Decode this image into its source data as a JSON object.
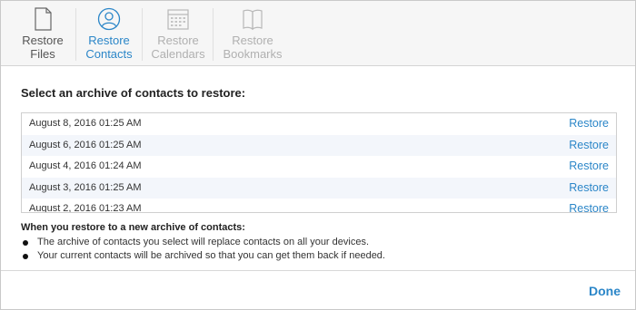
{
  "toolbar": {
    "tabs": [
      {
        "line1": "Restore",
        "line2": "Files",
        "icon": "document-icon",
        "state": "normal"
      },
      {
        "line1": "Restore",
        "line2": "Contacts",
        "icon": "contacts-icon",
        "state": "active"
      },
      {
        "line1": "Restore",
        "line2": "Calendars",
        "icon": "calendar-icon",
        "state": "disabled"
      },
      {
        "line1": "Restore",
        "line2": "Bookmarks",
        "icon": "bookmarks-icon",
        "state": "disabled"
      }
    ]
  },
  "main": {
    "heading": "Select an archive of contacts to restore:",
    "archives": [
      {
        "date": "August 8, 2016 01:25 AM",
        "action": "Restore"
      },
      {
        "date": "August 6, 2016 01:25 AM",
        "action": "Restore"
      },
      {
        "date": "August 4, 2016 01:24 AM",
        "action": "Restore"
      },
      {
        "date": "August 3, 2016 01:25 AM",
        "action": "Restore"
      },
      {
        "date": "August 2, 2016 01:23 AM",
        "action": "Restore"
      }
    ],
    "note_title": "When you restore to a new archive of contacts:",
    "bullets": [
      "The archive of contacts you select will replace contacts on all your devices.",
      "Your current contacts will be archived so that you can get them back if needed."
    ]
  },
  "footer": {
    "done_label": "Done"
  },
  "colors": {
    "accent": "#2b86c8",
    "disabled": "#b0b0b0",
    "row_alt": "#f3f6fb"
  }
}
